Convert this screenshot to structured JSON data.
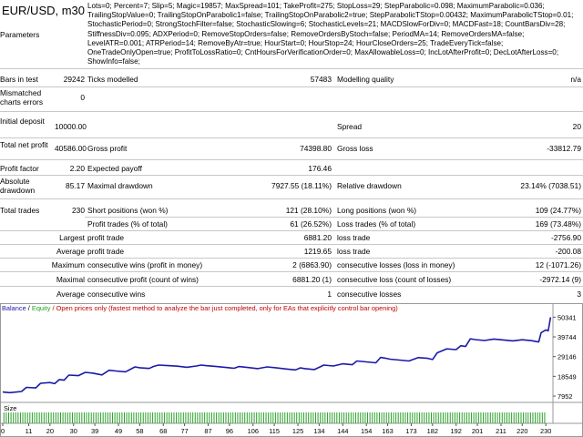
{
  "header": {
    "title": "EUR/USD, m30",
    "parameters_label": "Parameters",
    "parameters_text": "Lots=0; Percent=7; Slip=5; Magic=19857; MaxSpread=101; TakeProfit=275; StopLoss=29; StepParabolic=0.098; MaximumParabolic=0.036; TrailingStopValue=0; TrailingStopOnParabolic1=false; TrailingStopOnParabolic2=true; StepParabolicTStop=0.00432; MaximumParabolicTStop=0.01; StochasticPeriod=0; StrongStochFilter=false; StochasticSlowing=6; StochasticLevels=21; MACDSlowForDiv=0; MACDFast=18; CountBarsDiv=28; StiffnessDiv=0.095; ADXPeriod=0; RemoveStopOrders=false; RemoveOrdersByStoch=false; PeriodMA=14; RemoveOrdersMA=false; LevelATR=0.001; ATRPeriod=14; RemoveByAtr=true; HourStart=0; HourStop=24; HourCloseOrders=25; TradeEveryTick=false; OneTradeOnlyOpen=true; ProfitToLossRatio=0; CntHoursForVerificationOrder=0; MaxAllowableLoss=0; IncLotAfterProfit=0; DecLotAfterLoss=0; ShowInfo=false;"
  },
  "report": {
    "bars_in_test_label": "Bars in test",
    "bars_in_test": "29242",
    "ticks_modelled_label": "Ticks modelled",
    "ticks_modelled": "57483",
    "modelling_quality_label": "Modelling quality",
    "modelling_quality": "n/a",
    "mismatched_label": "Mismatched charts errors",
    "mismatched": "0",
    "initial_deposit_label": "Initial deposit",
    "initial_deposit": "10000.00",
    "spread_label": "Spread",
    "spread": "20",
    "total_net_profit_label": "Total net profit",
    "total_net_profit": "40586.00",
    "gross_profit_label": "Gross profit",
    "gross_profit": "74398.80",
    "gross_loss_label": "Gross loss",
    "gross_loss": "-33812.79",
    "profit_factor_label": "Profit factor",
    "profit_factor": "2.20",
    "expected_payoff_label": "Expected payoff",
    "expected_payoff": "176.46",
    "absolute_drawdown_label": "Absolute drawdown",
    "absolute_drawdown": "85.17",
    "maximal_drawdown_label": "Maximal drawdown",
    "maximal_drawdown": "7927.55 (18.11%)",
    "relative_drawdown_label": "Relative drawdown",
    "relative_drawdown": "23.14% (7038.51)",
    "total_trades_label": "Total trades",
    "total_trades": "230",
    "short_positions_label": "Short positions (won %)",
    "short_positions": "121 (28.10%)",
    "long_positions_label": "Long positions (won %)",
    "long_positions": "109 (24.77%)",
    "profit_trades_label": "Profit trades (% of total)",
    "profit_trades": "61 (26.52%)",
    "loss_trades_label": "Loss trades (% of total)",
    "loss_trades": "169 (73.48%)",
    "largest_label": "Largest",
    "largest_profit_label": "profit trade",
    "largest_profit": "6881.20",
    "largest_loss_label": "loss trade",
    "largest_loss": "-2756.90",
    "average_label": "Average",
    "average_profit_label": "profit trade",
    "average_profit": "1219.65",
    "average_loss_label": "loss trade",
    "average_loss": "-200.08",
    "maximum_label": "Maximum",
    "max_cons_wins_label": "consecutive wins (profit in money)",
    "max_cons_wins": "2 (6863.90)",
    "max_cons_losses_label": "consecutive losses (loss in money)",
    "max_cons_losses": "12 (-1071.26)",
    "maximal_label": "Maximal",
    "maximal_cons_profit_label": "consecutive profit (count of wins)",
    "maximal_cons_profit": "6881.20 (1)",
    "maximal_cons_loss_label": "consecutive loss (count of losses)",
    "maximal_cons_loss": "-2972.14 (9)",
    "average2_label": "Average",
    "avg_cons_wins_label": "consecutive wins",
    "avg_cons_wins": "1",
    "avg_cons_losses_label": "consecutive losses",
    "avg_cons_losses": "3"
  },
  "chart": {
    "legend_balance": "Balance",
    "legend_sep": " / ",
    "legend_equity": "Equity",
    "legend_note": " / Open prices only (fastest method to analyze the bar just completed, only for EAs that explicitly control bar opening)",
    "size_label": "Size",
    "balance_color": "#1a1aa8",
    "equity_color": "#2aa02a"
  },
  "chart_data": {
    "type": "line",
    "x_ticks": [
      0,
      11,
      20,
      30,
      39,
      49,
      58,
      68,
      77,
      87,
      96,
      106,
      115,
      125,
      134,
      144,
      154,
      163,
      173,
      182,
      192,
      201,
      211,
      220,
      230
    ],
    "y_ticks": [
      7952,
      18549,
      29146,
      39744,
      50341
    ],
    "ylim": [
      6500,
      51500
    ],
    "xlim": [
      0,
      233
    ],
    "series": [
      {
        "name": "Balance",
        "x": [
          0,
          3,
          8,
          10,
          14,
          16,
          20,
          22,
          24,
          26,
          28,
          32,
          35,
          38,
          40,
          42,
          45,
          48,
          52,
          56,
          58,
          62,
          64,
          66,
          70,
          74,
          78,
          82,
          84,
          86,
          90,
          94,
          98,
          100,
          104,
          108,
          112,
          116,
          120,
          124,
          126,
          128,
          132,
          136,
          140,
          144,
          148,
          150,
          154,
          158,
          160,
          162,
          164,
          168,
          172,
          176,
          180,
          182,
          184,
          188,
          192,
          194,
          196,
          198,
          200,
          204,
          208,
          212,
          216,
          220,
          224,
          226,
          227,
          228,
          230,
          231,
          232
        ],
        "y": [
          10100,
          9800,
          10400,
          12600,
          12300,
          14800,
          15200,
          14600,
          16800,
          16500,
          19200,
          18900,
          20700,
          20300,
          19800,
          19300,
          21800,
          21400,
          21000,
          23600,
          23200,
          22800,
          23900,
          24600,
          24300,
          24000,
          23400,
          24100,
          24600,
          24300,
          23900,
          23400,
          22900,
          23800,
          23300,
          22700,
          23600,
          23100,
          22500,
          22000,
          23100,
          22700,
          22200,
          24600,
          24100,
          25300,
          24800,
          26800,
          26300,
          25800,
          28700,
          28300,
          27800,
          27300,
          26800,
          28600,
          28200,
          27600,
          31200,
          33300,
          32900,
          35000,
          34600,
          38700,
          38300,
          37800,
          38600,
          38100,
          37600,
          38200,
          37700,
          37200,
          37000,
          42000,
          43500,
          43000,
          50300
        ]
      }
    ],
    "size_bars": 230,
    "xlabel": "",
    "ylabel": "",
    "title": ""
  }
}
